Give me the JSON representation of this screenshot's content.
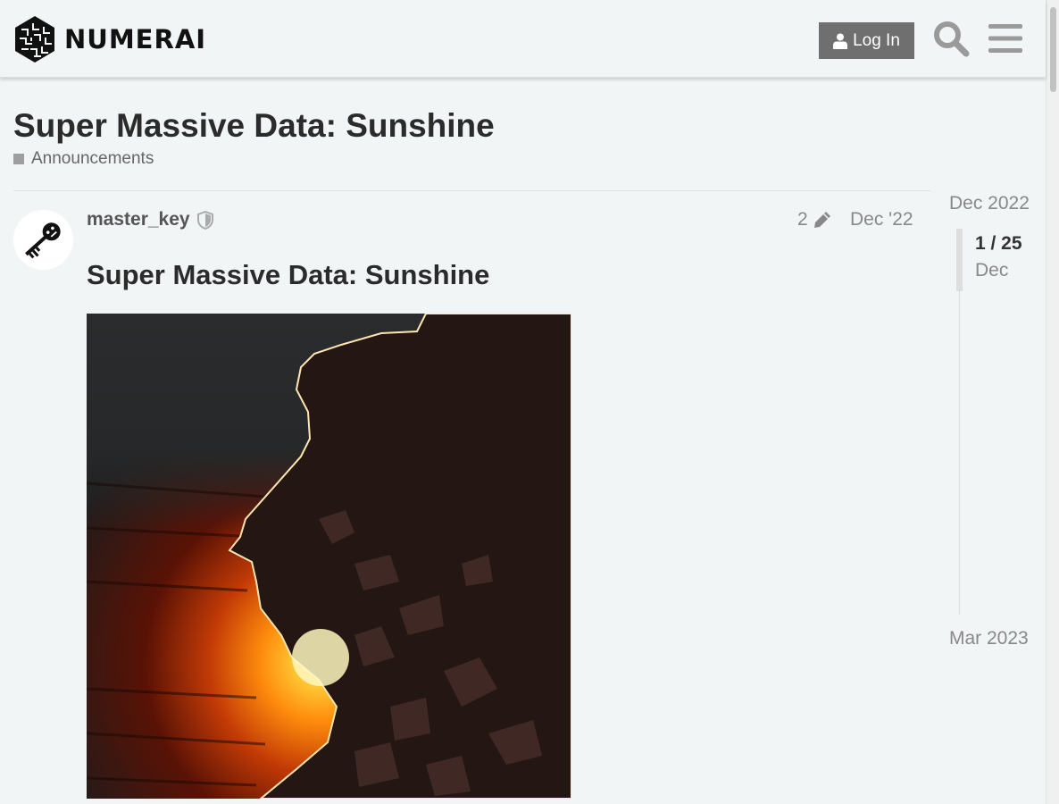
{
  "header": {
    "brand": "NUMERAI",
    "login_label": "Log In",
    "search_icon": "search-icon",
    "menu_icon": "hamburger-icon"
  },
  "topic": {
    "title": "Super Massive Data: Sunshine",
    "category": "Announcements",
    "category_color": "#9e9e9e"
  },
  "post": {
    "username": "master_key",
    "edit_count": "2",
    "date": "Dec '22",
    "heading": "Super Massive Data: Sunshine"
  },
  "timeline": {
    "start": "Dec 2022",
    "position": "1 / 25",
    "current_month": "Dec",
    "end": "Mar 2023"
  },
  "colors": {
    "background": "#f2f5f6",
    "button": "#6f6f6f",
    "muted_text": "#888888"
  }
}
